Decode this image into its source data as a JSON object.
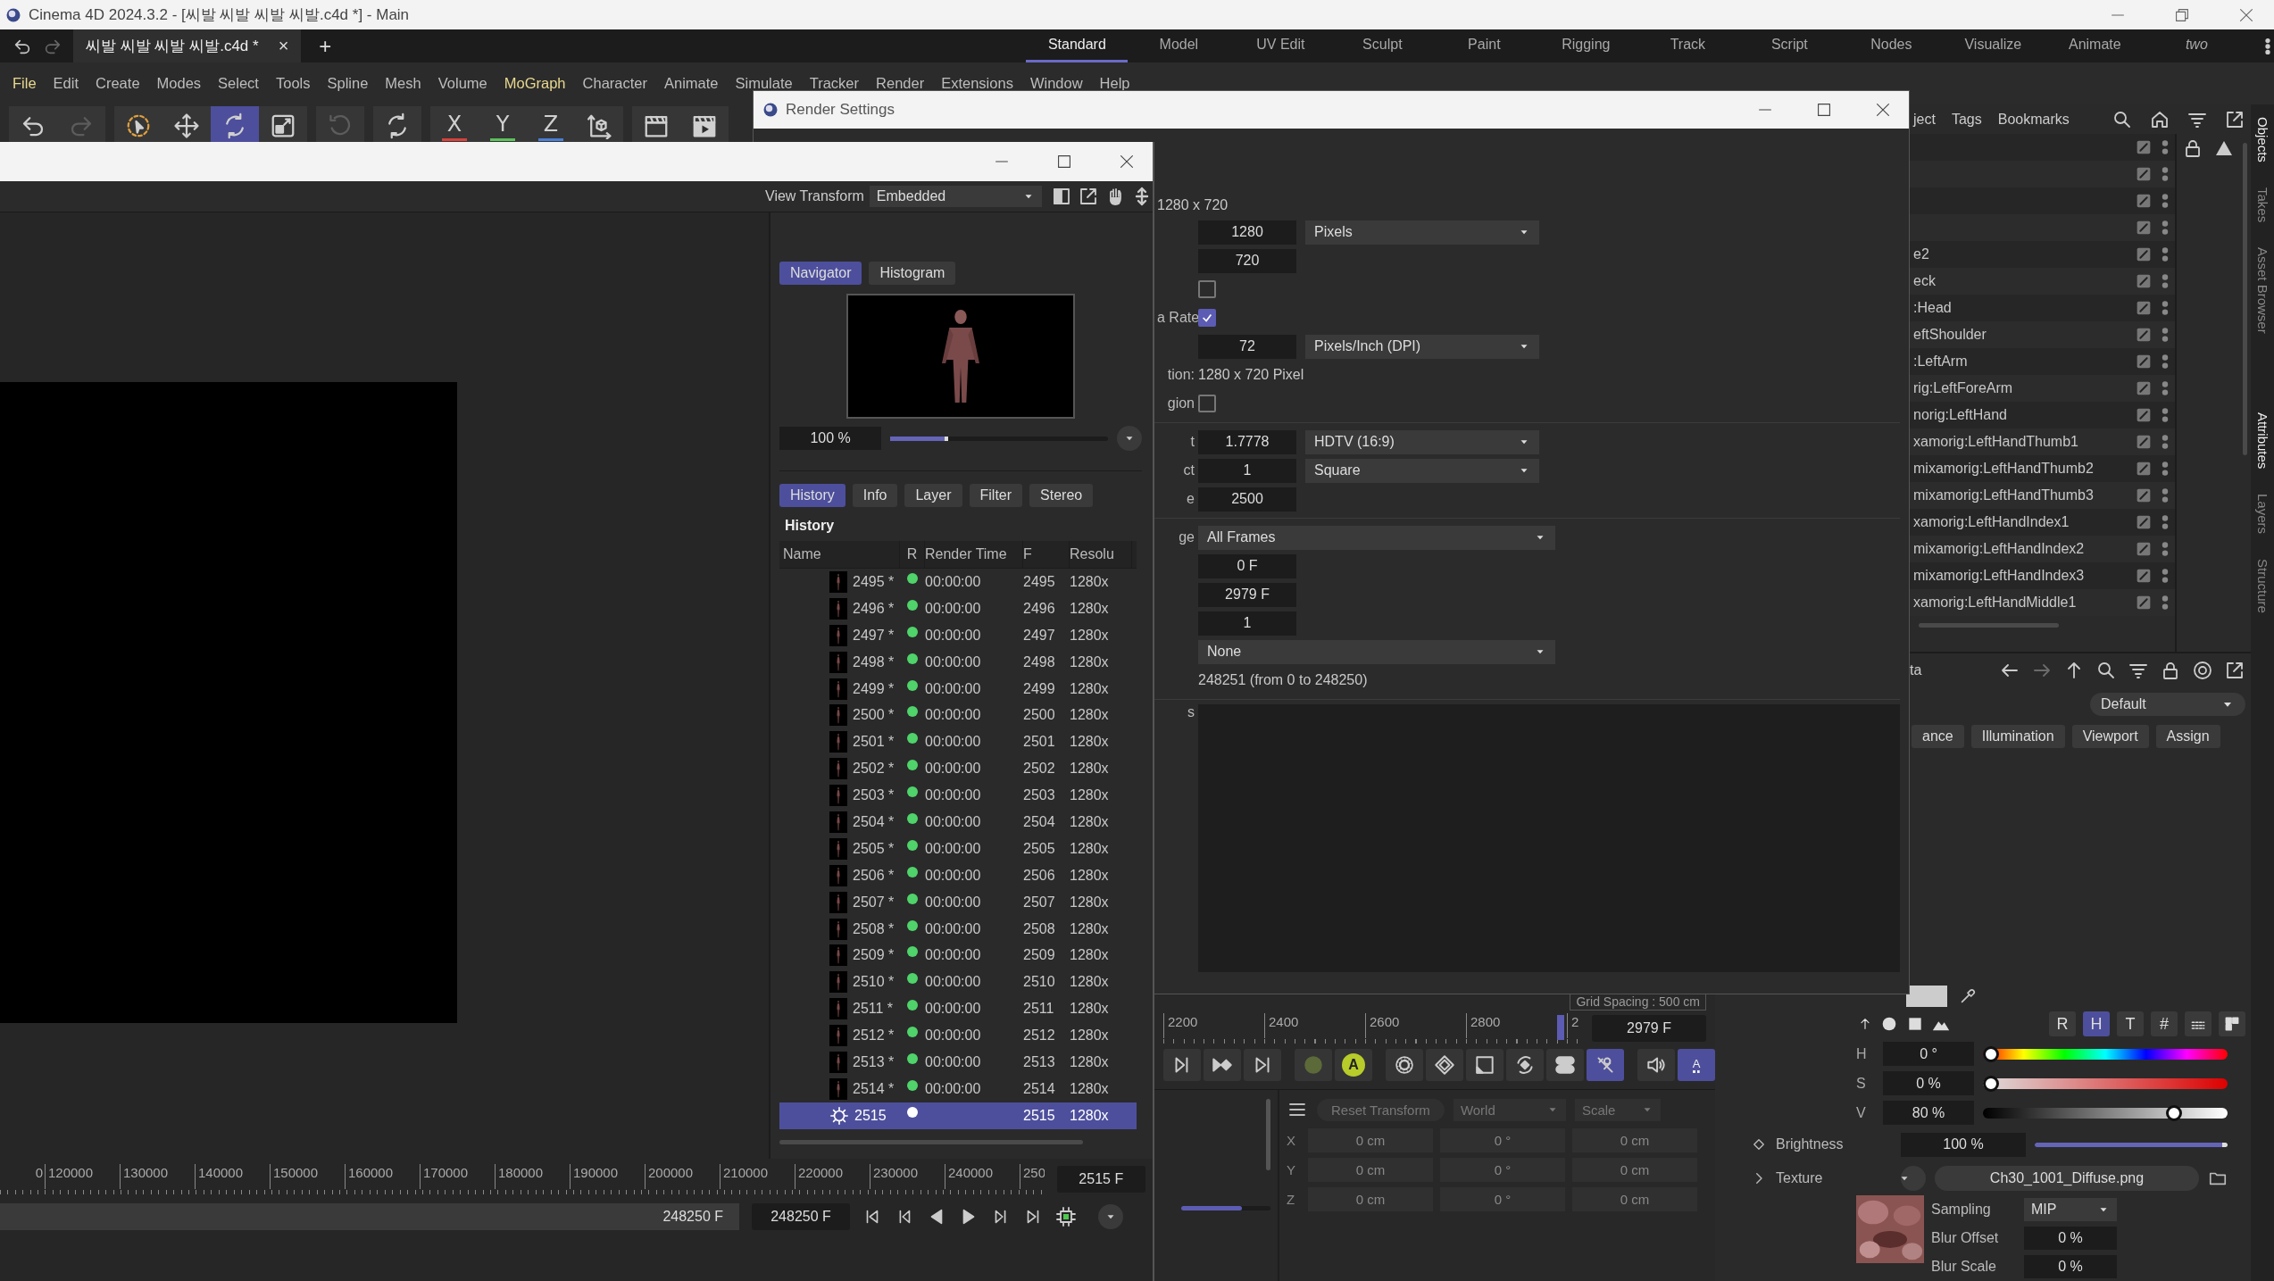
{
  "app": {
    "title": "Cinema 4D 2024.3.2 - [씨발 씨발 씨발 씨발.c4d *] - Main"
  },
  "document_tab": {
    "label": "씨발 씨발 씨발 씨발.c4d *",
    "close": "×",
    "add": "+"
  },
  "layouts": [
    {
      "label": "Standard",
      "selected": true,
      "custom": false
    },
    {
      "label": "Model",
      "selected": false,
      "custom": false
    },
    {
      "label": "UV Edit",
      "selected": false,
      "custom": false
    },
    {
      "label": "Sculpt",
      "selected": false,
      "custom": false
    },
    {
      "label": "Paint",
      "selected": false,
      "custom": false
    },
    {
      "label": "Rigging",
      "selected": false,
      "custom": false
    },
    {
      "label": "Track",
      "selected": false,
      "custom": false
    },
    {
      "label": "Script",
      "selected": false,
      "custom": false
    },
    {
      "label": "Nodes",
      "selected": false,
      "custom": false
    },
    {
      "label": "Visualize",
      "selected": false,
      "custom": false
    },
    {
      "label": "Animate",
      "selected": false,
      "custom": false
    },
    {
      "label": "two",
      "selected": false,
      "custom": true
    }
  ],
  "menu": [
    {
      "label": "File",
      "highlighted": true
    },
    {
      "label": "Edit",
      "highlighted": false
    },
    {
      "label": "Create",
      "highlighted": false
    },
    {
      "label": "Modes",
      "highlighted": false
    },
    {
      "label": "Select",
      "highlighted": false
    },
    {
      "label": "Tools",
      "highlighted": false
    },
    {
      "label": "Spline",
      "highlighted": false
    },
    {
      "label": "Mesh",
      "highlighted": false
    },
    {
      "label": "Volume",
      "highlighted": false
    },
    {
      "label": "MoGraph",
      "highlighted": true
    },
    {
      "label": "Character",
      "highlighted": false
    },
    {
      "label": "Animate",
      "highlighted": false
    },
    {
      "label": "Simulate",
      "highlighted": false
    },
    {
      "label": "Tracker",
      "highlighted": false
    },
    {
      "label": "Render",
      "highlighted": false
    },
    {
      "label": "Extensions",
      "highlighted": false
    },
    {
      "label": "Window",
      "highlighted": false
    },
    {
      "label": "Help",
      "highlighted": false
    }
  ],
  "toolbar": [
    {
      "kind": "undo",
      "selected": false,
      "disabled": false
    },
    {
      "kind": "redo",
      "selected": false,
      "disabled": true
    },
    {
      "kind": "select",
      "selected": false,
      "disabled": false
    },
    {
      "kind": "move",
      "selected": false,
      "disabled": false
    },
    {
      "kind": "rotate",
      "selected": true,
      "disabled": false
    },
    {
      "kind": "scale",
      "selected": false,
      "disabled": false
    },
    {
      "kind": "ring",
      "selected": false,
      "disabled": true
    },
    {
      "kind": "rotate",
      "selected": false,
      "disabled": false
    },
    {
      "kind": "axis",
      "label": "X",
      "color": "#d9413c",
      "selected": false,
      "disabled": false
    },
    {
      "kind": "axis",
      "label": "Y",
      "color": "#5cc25c",
      "selected": false,
      "disabled": false
    },
    {
      "kind": "axis",
      "label": "Z",
      "color": "#4a7fd6",
      "selected": false,
      "disabled": false
    },
    {
      "kind": "coord",
      "selected": false,
      "disabled": false
    },
    {
      "kind": "clapper",
      "selected": false,
      "disabled": false
    },
    {
      "kind": "render",
      "selected": false,
      "disabled": false
    }
  ],
  "objects": {
    "header": [
      "ject",
      "Tags",
      "Bookmarks"
    ],
    "rows": [
      {},
      {},
      {},
      {},
      {
        "name": "e2"
      },
      {
        "name": "eck"
      },
      {
        "name": ":Head"
      },
      {
        "name": "eftShoulder"
      },
      {
        "name": ":LeftArm"
      },
      {
        "name": "rig:LeftForeArm"
      },
      {
        "name": "norig:LeftHand"
      },
      {
        "name": "xamorig:LeftHandThumb1"
      },
      {
        "name": "mixamorig:LeftHandThumb2"
      },
      {
        "name": "mixamorig:LeftHandThumb3"
      },
      {
        "name": "xamorig:LeftHandIndex1"
      },
      {
        "name": "mixamorig:LeftHandIndex2"
      },
      {
        "name": "mixamorig:LeftHandIndex3"
      },
      {
        "name": "xamorig:LeftHandMiddle1"
      }
    ]
  },
  "side_tabs": [
    {
      "label": "Objects",
      "selected": true
    },
    {
      "label": "Takes",
      "selected": false
    },
    {
      "label": "Asset Browser",
      "selected": false
    },
    {
      "label": "Attributes",
      "selected": true
    },
    {
      "label": "Layers",
      "selected": false
    },
    {
      "label": "Structure",
      "selected": false
    }
  ],
  "attributes": {
    "header": "ta",
    "preset": "Default",
    "tabs": [
      {
        "label": "ance",
        "selected": false
      },
      {
        "label": "Illumination",
        "selected": false
      },
      {
        "label": "Viewport",
        "selected": false
      },
      {
        "label": "Assign",
        "selected": false
      }
    ],
    "color": "#cccccc",
    "color_modes": [
      {
        "label": "R",
        "selected": false
      },
      {
        "label": "H",
        "selected": true
      },
      {
        "label": "T",
        "selected": false
      },
      {
        "label": "#",
        "selected": false
      }
    ],
    "hsv": [
      {
        "label": "H",
        "value": "0 °",
        "level": 0,
        "kind": "hue"
      },
      {
        "label": "S",
        "value": "0 %",
        "level": 0,
        "kind": "saturation"
      },
      {
        "label": "V",
        "value": "80 %",
        "level": 0.8,
        "kind": "value"
      }
    ],
    "brightness": {
      "label": "Brightness",
      "value": "100 %",
      "level": 1
    },
    "texture": {
      "label": "Texture",
      "file": "Ch30_1001_Diffuse.png",
      "props": [
        {
          "label": "Sampling",
          "value": "MIP",
          "kind": "dropdown"
        },
        {
          "label": "Blur Offset",
          "value": "0 %",
          "kind": "field"
        },
        {
          "label": "Blur Scale",
          "value": "0 %",
          "kind": "field"
        }
      ]
    }
  },
  "timeline": {
    "grid_note": "Grid Spacing : 500 cm",
    "ticks": [
      "2200",
      "2400",
      "2600",
      "2800",
      "2"
    ],
    "end": "2979 F",
    "transport": [
      {
        "kind": "step",
        "selected": false
      },
      {
        "kind": "keystep",
        "selected": false
      },
      {
        "kind": "last",
        "selected": false
      },
      {
        "kind": "record",
        "selected": false
      },
      {
        "kind": "autokey",
        "label": "A",
        "selected": false
      },
      {
        "kind": "gear",
        "selected": false
      },
      {
        "kind": "keyframe",
        "selected": false
      },
      {
        "kind": "scalekey",
        "selected": false
      },
      {
        "kind": "rotatekey",
        "selected": false
      },
      {
        "kind": "toggle",
        "selected": false
      },
      {
        "kind": "snap",
        "selected": true
      },
      {
        "kind": "speaker",
        "selected": false
      },
      {
        "kind": "bars",
        "label": "A",
        "selected": true
      }
    ],
    "slider": {
      "level": 0.68
    }
  },
  "coordinates": {
    "reset": "Reset Transform",
    "space": "World",
    "mode": "Scale",
    "rows": [
      {
        "axis": "X",
        "values": [
          "0 cm",
          "0 °",
          "0 cm"
        ]
      },
      {
        "axis": "Y",
        "values": [
          "0 cm",
          "0 °",
          "0 cm"
        ]
      },
      {
        "axis": "Z",
        "values": [
          "0 cm",
          "0 °",
          "0 cm"
        ]
      }
    ]
  },
  "render_settings": {
    "title": "Render Settings",
    "size_note": "1280 x 720",
    "rows": [
      {
        "kind": "number",
        "value": "1280",
        "unit": "Pixels"
      },
      {
        "kind": "number",
        "value": "720"
      },
      {
        "kind": "checkbox",
        "checked": false
      },
      {
        "kind": "checkbox",
        "label": "a Rate",
        "checked": true
      },
      {
        "kind": "number",
        "value": "72",
        "unit": "Pixels/Inch (DPI)"
      },
      {
        "kind": "text",
        "label": "tion:",
        "value": "1280 x 720 Pixel"
      },
      {
        "kind": "checkbox",
        "label": "gion",
        "checked": false
      },
      {
        "kind": "separator"
      },
      {
        "kind": "number",
        "label": "t",
        "value": "1.7778",
        "unit": "HDTV (16:9)"
      },
      {
        "kind": "number",
        "label": "ct",
        "value": "1",
        "unit": "Square"
      },
      {
        "kind": "number",
        "label": "e",
        "value": "2500"
      },
      {
        "kind": "separator"
      },
      {
        "kind": "dropdown",
        "label": "ge",
        "value": "All Frames"
      },
      {
        "kind": "number",
        "value": "0 F"
      },
      {
        "kind": "number",
        "value": "2979 F"
      },
      {
        "kind": "number",
        "value": "1"
      },
      {
        "kind": "dropdown",
        "value": "None"
      },
      {
        "kind": "text",
        "value": "248251 (from 0 to 248250)"
      },
      {
        "kind": "separator"
      },
      {
        "kind": "notes",
        "label": "s"
      }
    ]
  },
  "picture_viewer": {
    "view_transform_label": "View Transform",
    "view_transform": "Embedded",
    "panel_tabs": [
      {
        "label": "Navigator",
        "selected": true
      },
      {
        "label": "Histogram",
        "selected": false
      }
    ],
    "zoom": "100 %",
    "zoom_slider": {
      "level": 0.25
    },
    "info_tabs": [
      {
        "label": "History",
        "selected": true
      },
      {
        "label": "Info",
        "selected": false
      },
      {
        "label": "Layer",
        "selected": false
      },
      {
        "label": "Filter",
        "selected": false
      },
      {
        "label": "Stereo",
        "selected": false
      }
    ],
    "history_title": "History",
    "columns": [
      "Name",
      "R",
      "Render Time",
      "F",
      "Resolu"
    ],
    "rows": [
      {
        "name": "2495 *",
        "done": true,
        "time": "00:00:00",
        "frame": "2495",
        "resolution": "1280x",
        "selected": false
      },
      {
        "name": "2496 *",
        "done": true,
        "time": "00:00:00",
        "frame": "2496",
        "resolution": "1280x",
        "selected": false
      },
      {
        "name": "2497 *",
        "done": true,
        "time": "00:00:00",
        "frame": "2497",
        "resolution": "1280x",
        "selected": false
      },
      {
        "name": "2498 *",
        "done": true,
        "time": "00:00:00",
        "frame": "2498",
        "resolution": "1280x",
        "selected": false
      },
      {
        "name": "2499 *",
        "done": true,
        "time": "00:00:00",
        "frame": "2499",
        "resolution": "1280x",
        "selected": false
      },
      {
        "name": "2500 *",
        "done": true,
        "time": "00:00:00",
        "frame": "2500",
        "resolution": "1280x",
        "selected": false
      },
      {
        "name": "2501 *",
        "done": true,
        "time": "00:00:00",
        "frame": "2501",
        "resolution": "1280x",
        "selected": false
      },
      {
        "name": "2502 *",
        "done": true,
        "time": "00:00:00",
        "frame": "2502",
        "resolution": "1280x",
        "selected": false
      },
      {
        "name": "2503 *",
        "done": true,
        "time": "00:00:00",
        "frame": "2503",
        "resolution": "1280x",
        "selected": false
      },
      {
        "name": "2504 *",
        "done": true,
        "time": "00:00:00",
        "frame": "2504",
        "resolution": "1280x",
        "selected": false
      },
      {
        "name": "2505 *",
        "done": true,
        "time": "00:00:00",
        "frame": "2505",
        "resolution": "1280x",
        "selected": false
      },
      {
        "name": "2506 *",
        "done": true,
        "time": "00:00:00",
        "frame": "2506",
        "resolution": "1280x",
        "selected": false
      },
      {
        "name": "2507 *",
        "done": true,
        "time": "00:00:00",
        "frame": "2507",
        "resolution": "1280x",
        "selected": false
      },
      {
        "name": "2508 *",
        "done": true,
        "time": "00:00:00",
        "frame": "2508",
        "resolution": "1280x",
        "selected": false
      },
      {
        "name": "2509 *",
        "done": true,
        "time": "00:00:00",
        "frame": "2509",
        "resolution": "1280x",
        "selected": false
      },
      {
        "name": "2510 *",
        "done": true,
        "time": "00:00:00",
        "frame": "2510",
        "resolution": "1280x",
        "selected": false
      },
      {
        "name": "2511 *",
        "done": true,
        "time": "00:00:00",
        "frame": "2511",
        "resolution": "1280x",
        "selected": false
      },
      {
        "name": "2512 *",
        "done": true,
        "time": "00:00:00",
        "frame": "2512",
        "resolution": "1280x",
        "selected": false
      },
      {
        "name": "2513 *",
        "done": true,
        "time": "00:00:00",
        "frame": "2513",
        "resolution": "1280x",
        "selected": false
      },
      {
        "name": "2514 *",
        "done": true,
        "time": "00:00:00",
        "frame": "2514",
        "resolution": "1280x",
        "selected": false
      },
      {
        "name": "2515",
        "done": false,
        "frame": "2515",
        "resolution": "1280x",
        "selected": true
      }
    ],
    "timeline": {
      "ticks": [
        "0",
        "120000",
        "130000",
        "140000",
        "150000",
        "160000",
        "170000",
        "180000",
        "190000",
        "200000",
        "210000",
        "220000",
        "230000",
        "240000",
        "250"
      ],
      "current": "2515 F",
      "end_label": "248250 F",
      "end_field": "248250 F"
    }
  }
}
